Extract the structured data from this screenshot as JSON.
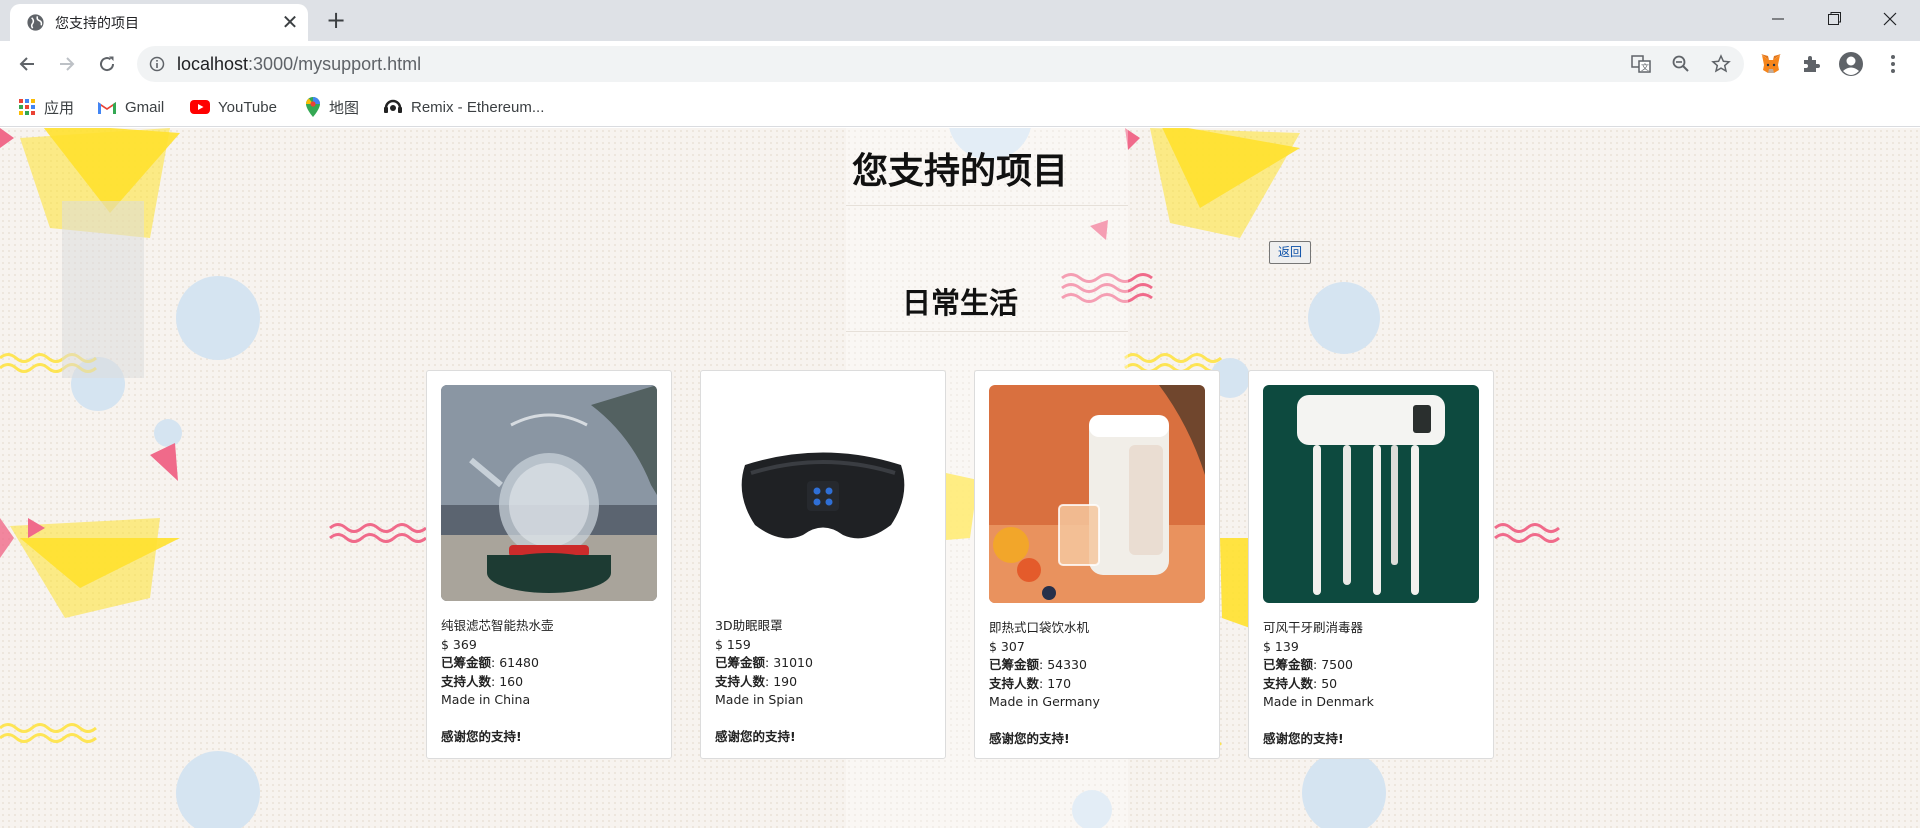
{
  "browser": {
    "tab_title": "您支持的项目",
    "url_host": "localhost",
    "url_rest": ":3000/mysupport.html",
    "bookmarks": [
      "应用",
      "Gmail",
      "YouTube",
      "地图",
      "Remix - Ethereum..."
    ]
  },
  "page": {
    "title": "您支持的项目",
    "back_label": "返回",
    "section_title": "日常生活"
  },
  "labels": {
    "raised": "已筹金额",
    "backers": "支持人数",
    "thanks": "感谢您的支持!"
  },
  "cards": [
    {
      "name": "纯银滤芯智能热水壶",
      "price": "$ 369",
      "raised": ": 61480",
      "backers": ": 160",
      "origin": "Made in China",
      "image": "kettle"
    },
    {
      "name": "3D助眠眼罩",
      "price": "$ 159",
      "raised": ": 31010",
      "backers": ": 190",
      "origin": "Made in Spian",
      "image": "eye-mask"
    },
    {
      "name": "即热式口袋饮水机",
      "price": "$ 307",
      "raised": ": 54330",
      "backers": ": 170",
      "origin": "Made in Germany",
      "image": "water-dispenser"
    },
    {
      "name": "可风干牙刷消毒器",
      "price": "$ 139",
      "raised": ": 7500",
      "backers": ": 50",
      "origin": "Made in Denmark",
      "image": "toothbrush-sterilizer"
    }
  ],
  "colors": {
    "tabbar": "#dee1e6",
    "page_bg": "#f7f3ef",
    "deco_yellow": "#ffe12e",
    "deco_pink": "#f06a8a",
    "deco_blue": "#d5e4f1"
  }
}
